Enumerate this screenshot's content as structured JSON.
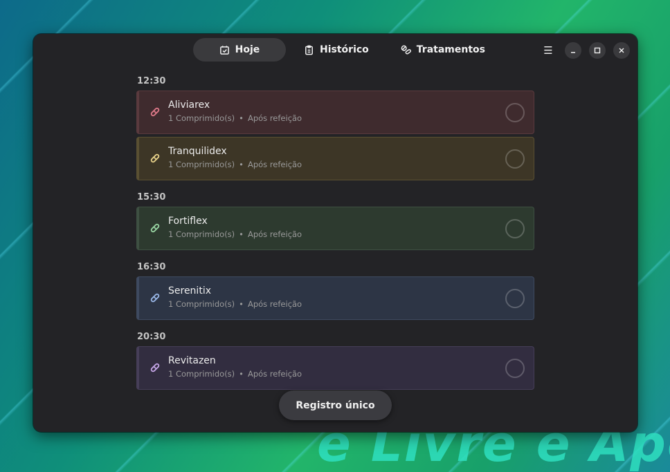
{
  "desktop": {
    "wallpaper_text": "e Livre e Apo"
  },
  "tabs": [
    {
      "label": "Hoje",
      "icon": "calendar-check-icon",
      "active": true
    },
    {
      "label": "Histórico",
      "icon": "clipboard-icon",
      "active": false
    },
    {
      "label": "Tratamentos",
      "icon": "pills-icon",
      "active": false
    }
  ],
  "window_controls": {
    "menu": "☰",
    "minimize": "minimize-icon",
    "maximize": "maximize-icon",
    "close": "close-icon"
  },
  "schedule": [
    {
      "time": "12:30",
      "items": [
        {
          "name": "Aliviarex",
          "dose": "1 Comprimido(s)",
          "separator": "•",
          "note": "Após refeição",
          "color": "#e07a8a",
          "bg": "#3f2b2e",
          "border": "#5a3a3e"
        },
        {
          "name": "Tranquilidex",
          "dose": "1 Comprimido(s)",
          "separator": "•",
          "note": "Após refeição",
          "color": "#e8d28a",
          "bg": "#3d3626",
          "border": "#5a5032"
        }
      ]
    },
    {
      "time": "15:30",
      "items": [
        {
          "name": "Fortiflex",
          "dose": "1 Comprimido(s)",
          "separator": "•",
          "note": "Após refeição",
          "color": "#9ad7a4",
          "bg": "#2d3a2f",
          "border": "#3e5042"
        }
      ]
    },
    {
      "time": "16:30",
      "items": [
        {
          "name": "Serenitix",
          "dose": "1 Comprimido(s)",
          "separator": "•",
          "note": "Após refeição",
          "color": "#9ab8e8",
          "bg": "#2d3545",
          "border": "#3e4a60"
        }
      ]
    },
    {
      "time": "20:30",
      "items": [
        {
          "name": "Revitazen",
          "dose": "1 Comprimido(s)",
          "separator": "•",
          "note": "Após refeição",
          "color": "#c6a6e8",
          "bg": "#322d40",
          "border": "#463e58"
        }
      ]
    }
  ],
  "fab_label": "Registro único"
}
